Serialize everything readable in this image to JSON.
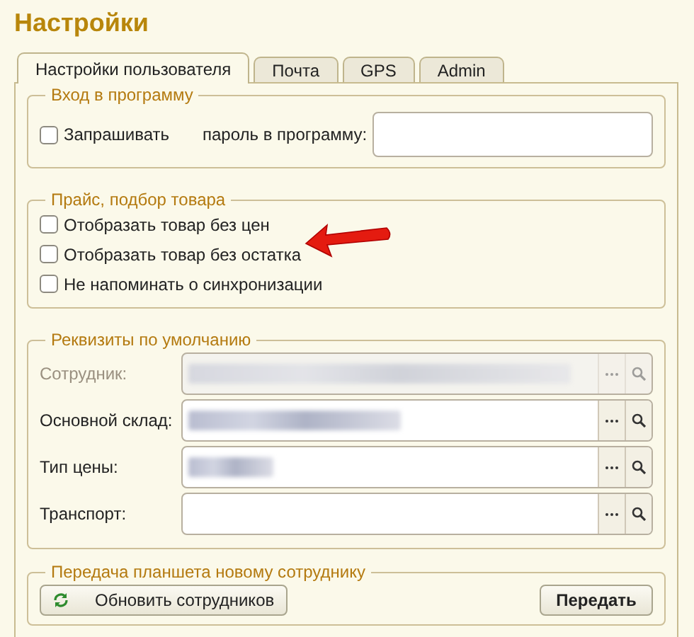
{
  "title": "Настройки",
  "tabs": [
    {
      "label": "Настройки пользователя",
      "selected": true
    },
    {
      "label": "Почта",
      "selected": false
    },
    {
      "label": "GPS",
      "selected": false
    },
    {
      "label": "Admin",
      "selected": false
    }
  ],
  "login_group": {
    "legend": "Вход в программу",
    "checkbox": {
      "label": "Запрашивать",
      "checked": false
    },
    "password_label": "пароль в программу:"
  },
  "price_group": {
    "legend": "Прайс, подбор товара",
    "options": [
      {
        "label": "Отобразать товар без цен",
        "checked": false
      },
      {
        "label": "Отобразать товар без остатка",
        "checked": false
      },
      {
        "label": "Не напоминать о синхронизации",
        "checked": false
      }
    ]
  },
  "defaults_group": {
    "legend": "Реквизиты по умолчанию",
    "fields": [
      {
        "label": "Сотрудник:",
        "disabled": true,
        "value_blurred": true
      },
      {
        "label": "Основной склад:",
        "disabled": false,
        "value_blurred": true
      },
      {
        "label": "Тип цены:",
        "disabled": false,
        "value_blurred": true
      },
      {
        "label": "Транспорт:",
        "disabled": false,
        "value_blurred": false
      }
    ]
  },
  "transfer_group": {
    "legend": "Передача планшета новому сотруднику",
    "refresh_button": "Обновить сотрудников",
    "transfer_button": "Передать"
  }
}
